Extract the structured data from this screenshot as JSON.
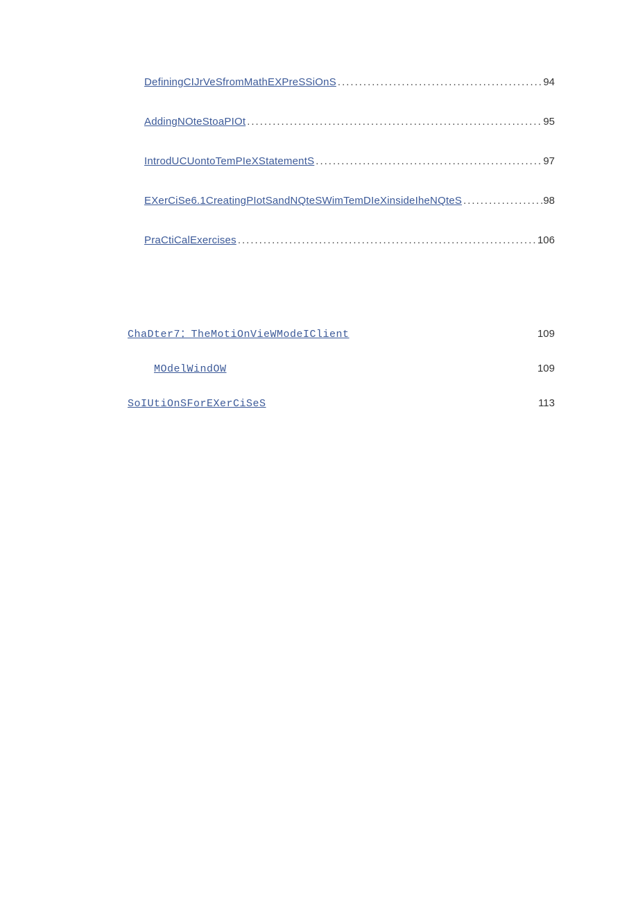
{
  "toc": {
    "dotted_entries": [
      {
        "label": "DefiningCIJrVeSfromMathEXPreSSiOnS",
        "page": "94"
      },
      {
        "label": "AddingNOteStoaPIOt",
        "page": "95"
      },
      {
        "label": "IntrodUCUontoTemPIeXStatementS",
        "page": "97"
      },
      {
        "label": "EXerCiSe6.1CreatingPIotSandNQteSWimTemDIeXinsideIheNQteS",
        "page": "98"
      },
      {
        "label": "PraCtiCalExercises",
        "page": "106"
      }
    ],
    "mono_entries": [
      {
        "label": "ChaDter7：TheMotiOnVieWModeIClient",
        "page": "109",
        "indent": 0
      },
      {
        "label": "MOdelWindOW",
        "page": "109",
        "indent": 1
      },
      {
        "label": "SoIUtiOnSForEXerCiSeS",
        "page": "113",
        "indent": 0
      }
    ]
  }
}
